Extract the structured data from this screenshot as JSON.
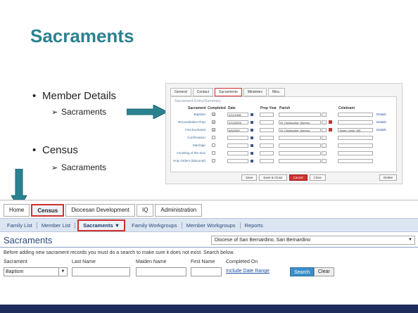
{
  "slide": {
    "title": "Sacraments",
    "bullet1": "Member Details",
    "sub1": "Sacraments",
    "bullet2": "Census",
    "sub2": "Sacraments",
    "footer_color": "#1f2d5c"
  },
  "inset": {
    "tabs": [
      "General",
      "Contact",
      "Sacraments",
      "Ministries",
      "Misc."
    ],
    "active_tab": "Sacraments",
    "heading": "Sacrament Entry/Summary",
    "headers": {
      "sacrament": "Sacrament",
      "completed": "Completed",
      "date": "Date",
      "prep_year": "Prep Year",
      "parish": "Parish",
      "celebrant": "Celebrant"
    },
    "rows": [
      {
        "label": "Baptism:",
        "checked": "☑",
        "date": "4/11/1998",
        "parish": "",
        "celebrant": "",
        "details": "Details"
      },
      {
        "label": "Reconciliation Prep:",
        "checked": "☑",
        "date": "2/13/2009",
        "parish": "St. Christopher, Moreno",
        "celebrant": "",
        "details": "Details"
      },
      {
        "label": "First Eucharist:",
        "checked": "☑",
        "date": "6/6/2009",
        "parish": "St. Christopher, Moreno",
        "celebrant": "Jowen Junio, MS",
        "details": "Details"
      },
      {
        "label": "Confirmation:",
        "checked": "",
        "date": "",
        "parish": "",
        "celebrant": "",
        "details": ""
      },
      {
        "label": "Marriage:",
        "checked": "",
        "date": "",
        "parish": "",
        "celebrant": "",
        "details": ""
      },
      {
        "label": "Anointing of the Sick:",
        "checked": "",
        "date": "",
        "parish": "",
        "celebrant": "",
        "details": ""
      },
      {
        "label": "Holy Orders (Diaconal):",
        "checked": "",
        "date": "",
        "parish": "",
        "celebrant": "",
        "details": ""
      }
    ],
    "buttons": {
      "save": "Save",
      "save_close": "Save & Close",
      "cancel": "Cancel",
      "close": "Close",
      "delete": "Delete"
    }
  },
  "app": {
    "top_tabs": [
      "Home",
      "Census",
      "Diocesan Development",
      "IQ",
      "Administration"
    ],
    "active_top_tab": "Census",
    "sub_nav": [
      "Family List",
      "Member List",
      "Sacraments ▼",
      "Family Workgroups",
      "Member Workgroups",
      "Reports"
    ],
    "active_sub_nav": "Sacraments ▼",
    "page_title": "Sacraments",
    "diocese": "Diocese of San Bernardino, San Bernardino",
    "instructions": "Before adding new sacrament records you must do a search to make sure it does not exist. Search below.",
    "fields": {
      "sacrament_label": "Sacrament",
      "sacrament_value": "Baptism",
      "last_name_label": "Last Name",
      "maiden_name_label": "Maiden Name",
      "first_name_label": "First Name",
      "completed_on_label": "Completed On",
      "include_date_range": "Include Date Range"
    },
    "search_button": "Search",
    "clear_button": "Clear"
  }
}
